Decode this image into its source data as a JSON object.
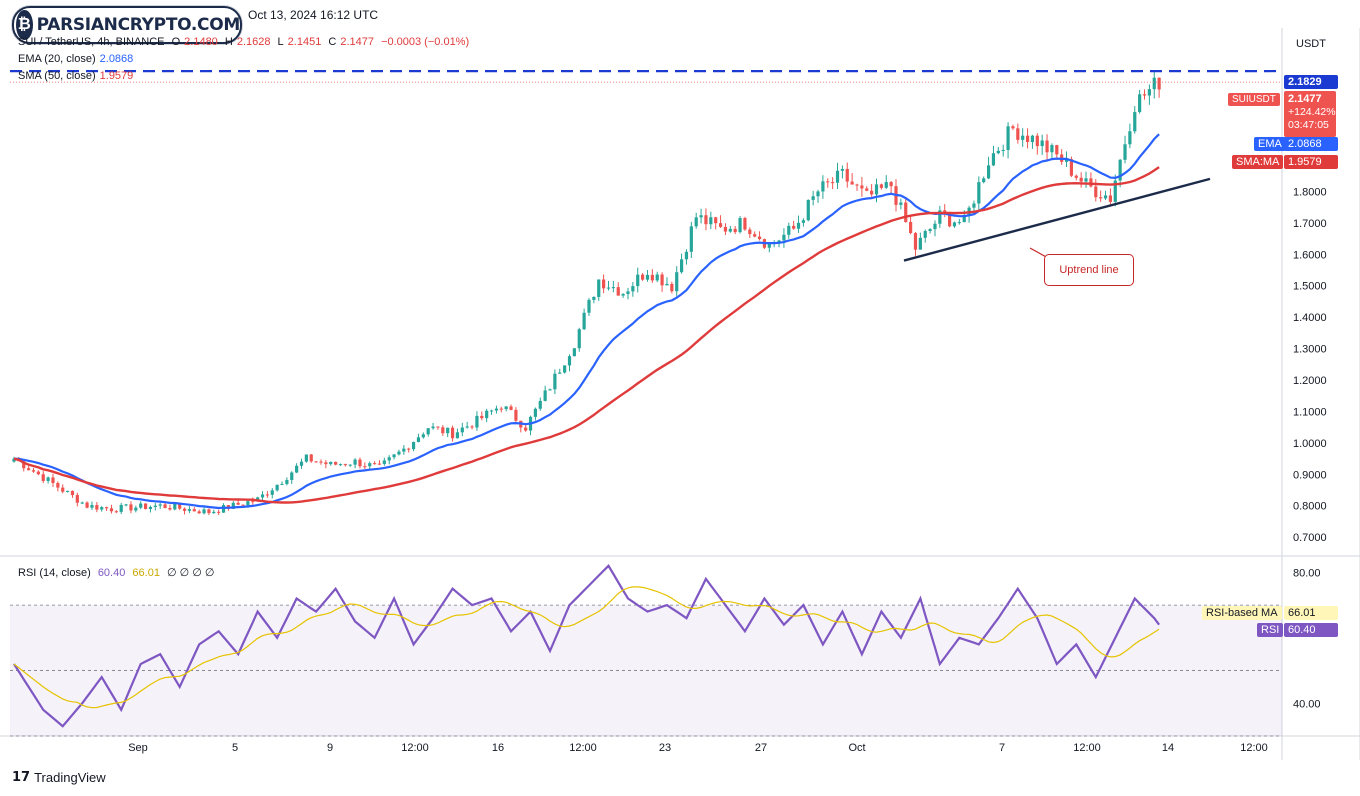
{
  "header": {
    "symbol_line": "SUI / TetherUS, 4h, BINANCE",
    "o_label": "O",
    "o_value": "2.1480",
    "h_label": "H",
    "h_value": "2.1628",
    "l_label": "L",
    "l_value": "2.1451",
    "c_label": "C",
    "c_value": "2.1477",
    "change": "−0.0003 (−0.01%)",
    "ema_label": "EMA (20, close)",
    "ema_value": "2.0868",
    "sma_label": "SMA (50, close)",
    "sma_value": "1.9579",
    "rsi_label": "RSI (14, close)",
    "rsi_value": "60.40",
    "rsi_ma_value": "66.01",
    "rsi_extra": "∅ ∅ ∅ ∅"
  },
  "title_top": "Oct 13, 2024 16:12 UTC",
  "watermark": {
    "text": "PARSIANCRYPTO.COM",
    "glyph": "₿"
  },
  "currency": "USDT",
  "tags": {
    "resistance": "2.1829",
    "symbol": "SUIUSDT",
    "price": "2.1477",
    "change_pct": "+124.42%",
    "countdown": "03:47:05",
    "ema_name": "EMA",
    "ema_value": "2.0868",
    "sma_name": "SMA:MA",
    "sma_value": "1.9579",
    "rsi_ma_name": "RSI-based MA",
    "rsi_ma_value": "66.01",
    "rsi_name": "RSI",
    "rsi_value": "60.40"
  },
  "annotation": "Uptrend line",
  "footer": {
    "brand": "TradingView",
    "mark": "17"
  },
  "colors": {
    "up": "#26a69a",
    "down": "#ef5350",
    "ema": "#2962ff",
    "sma": "#e03b3b",
    "rsi": "#7e57c2",
    "rsi_ma": "#e6c300",
    "trendline": "#1c2b4a",
    "resistance": "#1a3ad1"
  },
  "chart_data": [
    {
      "type": "candlestick",
      "title": "SUI / TetherUS, 4h, BINANCE",
      "ylim": [
        0.64,
        2.32
      ],
      "y_ticks": [
        "0.7000",
        "0.8000",
        "0.9000",
        "1.0000",
        "1.1000",
        "1.2000",
        "1.3000",
        "1.4000",
        "1.5000",
        "1.6000",
        "1.7000",
        "1.8000",
        "1.9000"
      ],
      "x_ticks": [
        "Sep",
        "5",
        "9",
        "12:00",
        "16",
        "12:00",
        "23",
        "27",
        "Oct",
        "7",
        "12:00",
        "14",
        "12:00"
      ],
      "close_path": [
        [
          0,
          0.95
        ],
        [
          5,
          0.9
        ],
        [
          10,
          0.85
        ],
        [
          15,
          0.8
        ],
        [
          20,
          0.79
        ],
        [
          30,
          0.8
        ],
        [
          40,
          0.78
        ],
        [
          45,
          0.8
        ],
        [
          50,
          0.82
        ],
        [
          55,
          0.88
        ],
        [
          60,
          0.95
        ],
        [
          65,
          0.93
        ],
        [
          70,
          0.94
        ],
        [
          75,
          0.92
        ],
        [
          80,
          0.98
        ],
        [
          85,
          1.05
        ],
        [
          90,
          1.03
        ],
        [
          95,
          1.07
        ],
        [
          100,
          1.12
        ],
        [
          105,
          1.05
        ],
        [
          110,
          1.18
        ],
        [
          115,
          1.32
        ],
        [
          120,
          1.52
        ],
        [
          125,
          1.48
        ],
        [
          130,
          1.55
        ],
        [
          135,
          1.5
        ],
        [
          140,
          1.72
        ],
        [
          145,
          1.68
        ],
        [
          150,
          1.7
        ],
        [
          155,
          1.63
        ],
        [
          160,
          1.68
        ],
        [
          165,
          1.8
        ],
        [
          170,
          1.85
        ],
        [
          175,
          1.78
        ],
        [
          180,
          1.82
        ],
        [
          185,
          1.62
        ],
        [
          190,
          1.72
        ],
        [
          195,
          1.7
        ],
        [
          200,
          1.9
        ],
        [
          205,
          2.0
        ],
        [
          210,
          1.96
        ],
        [
          215,
          1.9
        ],
        [
          220,
          1.82
        ],
        [
          225,
          1.78
        ],
        [
          230,
          2.08
        ],
        [
          235,
          2.15
        ]
      ],
      "ema20_label": "EMA (20, close)",
      "ema20_last": 2.0868,
      "sma50_label": "SMA (50, close)",
      "sma50_last": 1.9579,
      "resistance": 2.1829,
      "last_price": 2.1477,
      "trendline": [
        [
          1.58,
          "Oct 2"
        ],
        [
          1.84,
          "Oct 14"
        ]
      ],
      "annotation": "Uptrend line"
    },
    {
      "type": "line",
      "title": "RSI (14, close)",
      "ylim": [
        30,
        85
      ],
      "y_ticks": [
        "40.00",
        "80.00"
      ],
      "bands": [
        30,
        50,
        70
      ],
      "rsi_last": 60.4,
      "rsi_ma_last": 66.01,
      "rsi_path": [
        [
          0,
          52
        ],
        [
          3,
          45
        ],
        [
          6,
          38
        ],
        [
          10,
          33
        ],
        [
          14,
          40
        ],
        [
          18,
          48
        ],
        [
          22,
          38
        ],
        [
          26,
          52
        ],
        [
          30,
          55
        ],
        [
          34,
          45
        ],
        [
          38,
          58
        ],
        [
          42,
          62
        ],
        [
          46,
          55
        ],
        [
          50,
          68
        ],
        [
          54,
          60
        ],
        [
          58,
          72
        ],
        [
          62,
          68
        ],
        [
          66,
          75
        ],
        [
          70,
          65
        ],
        [
          74,
          60
        ],
        [
          78,
          72
        ],
        [
          82,
          58
        ],
        [
          86,
          66
        ],
        [
          90,
          75
        ],
        [
          94,
          70
        ],
        [
          98,
          72
        ],
        [
          102,
          62
        ],
        [
          106,
          68
        ],
        [
          110,
          56
        ],
        [
          114,
          70
        ],
        [
          118,
          76
        ],
        [
          122,
          82
        ],
        [
          126,
          72
        ],
        [
          130,
          68
        ],
        [
          134,
          70
        ],
        [
          138,
          66
        ],
        [
          142,
          78
        ],
        [
          146,
          70
        ],
        [
          150,
          62
        ],
        [
          154,
          72
        ],
        [
          158,
          64
        ],
        [
          162,
          70
        ],
        [
          166,
          58
        ],
        [
          170,
          68
        ],
        [
          174,
          55
        ],
        [
          178,
          68
        ],
        [
          182,
          60
        ],
        [
          186,
          72
        ],
        [
          190,
          52
        ],
        [
          194,
          60
        ],
        [
          198,
          58
        ],
        [
          202,
          66
        ],
        [
          206,
          75
        ],
        [
          210,
          66
        ],
        [
          214,
          52
        ],
        [
          218,
          58
        ],
        [
          222,
          48
        ],
        [
          226,
          60
        ],
        [
          230,
          72
        ],
        [
          234,
          66
        ],
        [
          236,
          62
        ]
      ]
    }
  ]
}
